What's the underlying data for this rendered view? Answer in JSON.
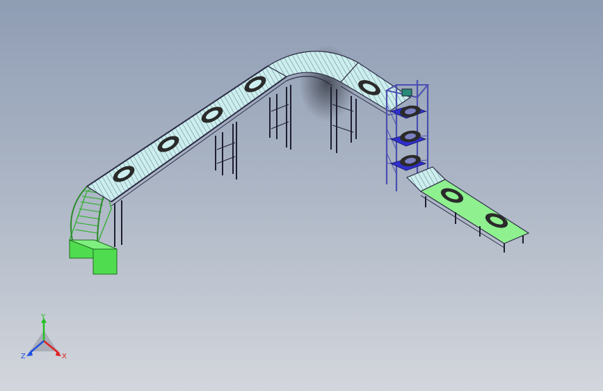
{
  "viewport": {
    "scene": "conveyor-assembly-isometric",
    "colors": {
      "background_top": "#8f9db4",
      "background_bottom": "#d3d6dc",
      "rollers": "#bfe6e6",
      "frame": "#2b2b45",
      "tower": "#5a5fc0",
      "tower_pallet": "#2f2fd0",
      "green_part": "#55e055",
      "tire": "#2a2a2a"
    }
  },
  "triad": {
    "y_label": "Y",
    "x_label": "X",
    "z_label": "Z",
    "colors": {
      "x": "#e02020",
      "y": "#20c020",
      "z": "#2050e0"
    }
  }
}
